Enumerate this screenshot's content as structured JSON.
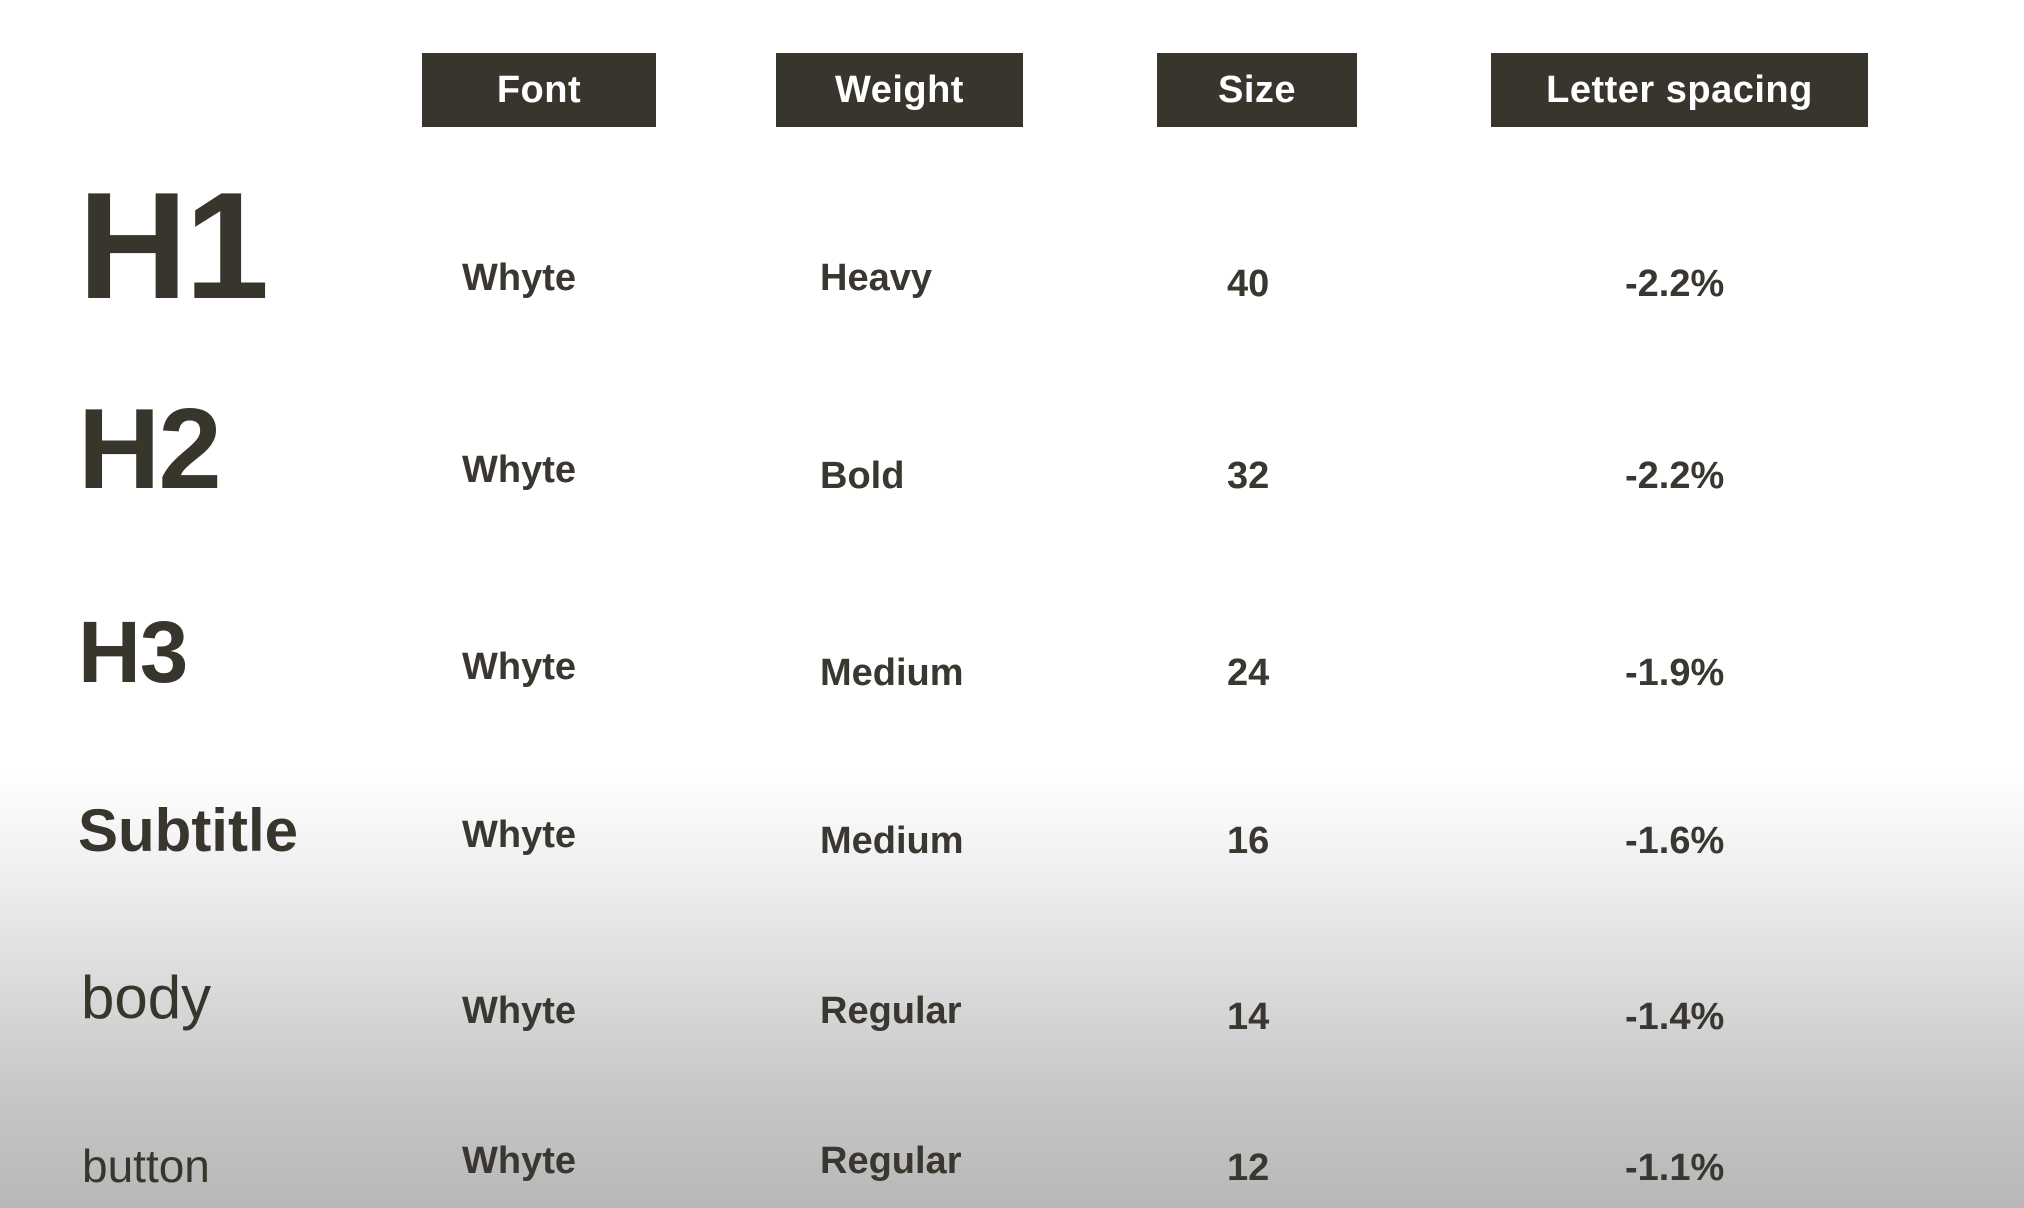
{
  "headers": {
    "font": "Font",
    "weight": "Weight",
    "size": "Size",
    "letter_spacing": "Letter spacing"
  },
  "rows": [
    {
      "style": "H1",
      "font": "Whyte",
      "weight": "Heavy",
      "size": "40",
      "letter_spacing": "-2.2%"
    },
    {
      "style": "H2",
      "font": "Whyte",
      "weight": "Bold",
      "size": "32",
      "letter_spacing": "-2.2%"
    },
    {
      "style": "H3",
      "font": "Whyte",
      "weight": "Medium",
      "size": "24",
      "letter_spacing": "-1.9%"
    },
    {
      "style": "Subtitle",
      "font": "Whyte",
      "weight": "Medium",
      "size": "16",
      "letter_spacing": "-1.6%"
    },
    {
      "style": "body",
      "font": "Whyte",
      "weight": "Regular",
      "size": "14",
      "letter_spacing": "-1.4%"
    },
    {
      "style": "button",
      "font": "Whyte",
      "weight": "Regular",
      "size": "12",
      "letter_spacing": "-1.1%"
    }
  ],
  "colors": {
    "header_bg": "#38352d",
    "header_text": "#ffffff",
    "text": "#3a3730"
  }
}
